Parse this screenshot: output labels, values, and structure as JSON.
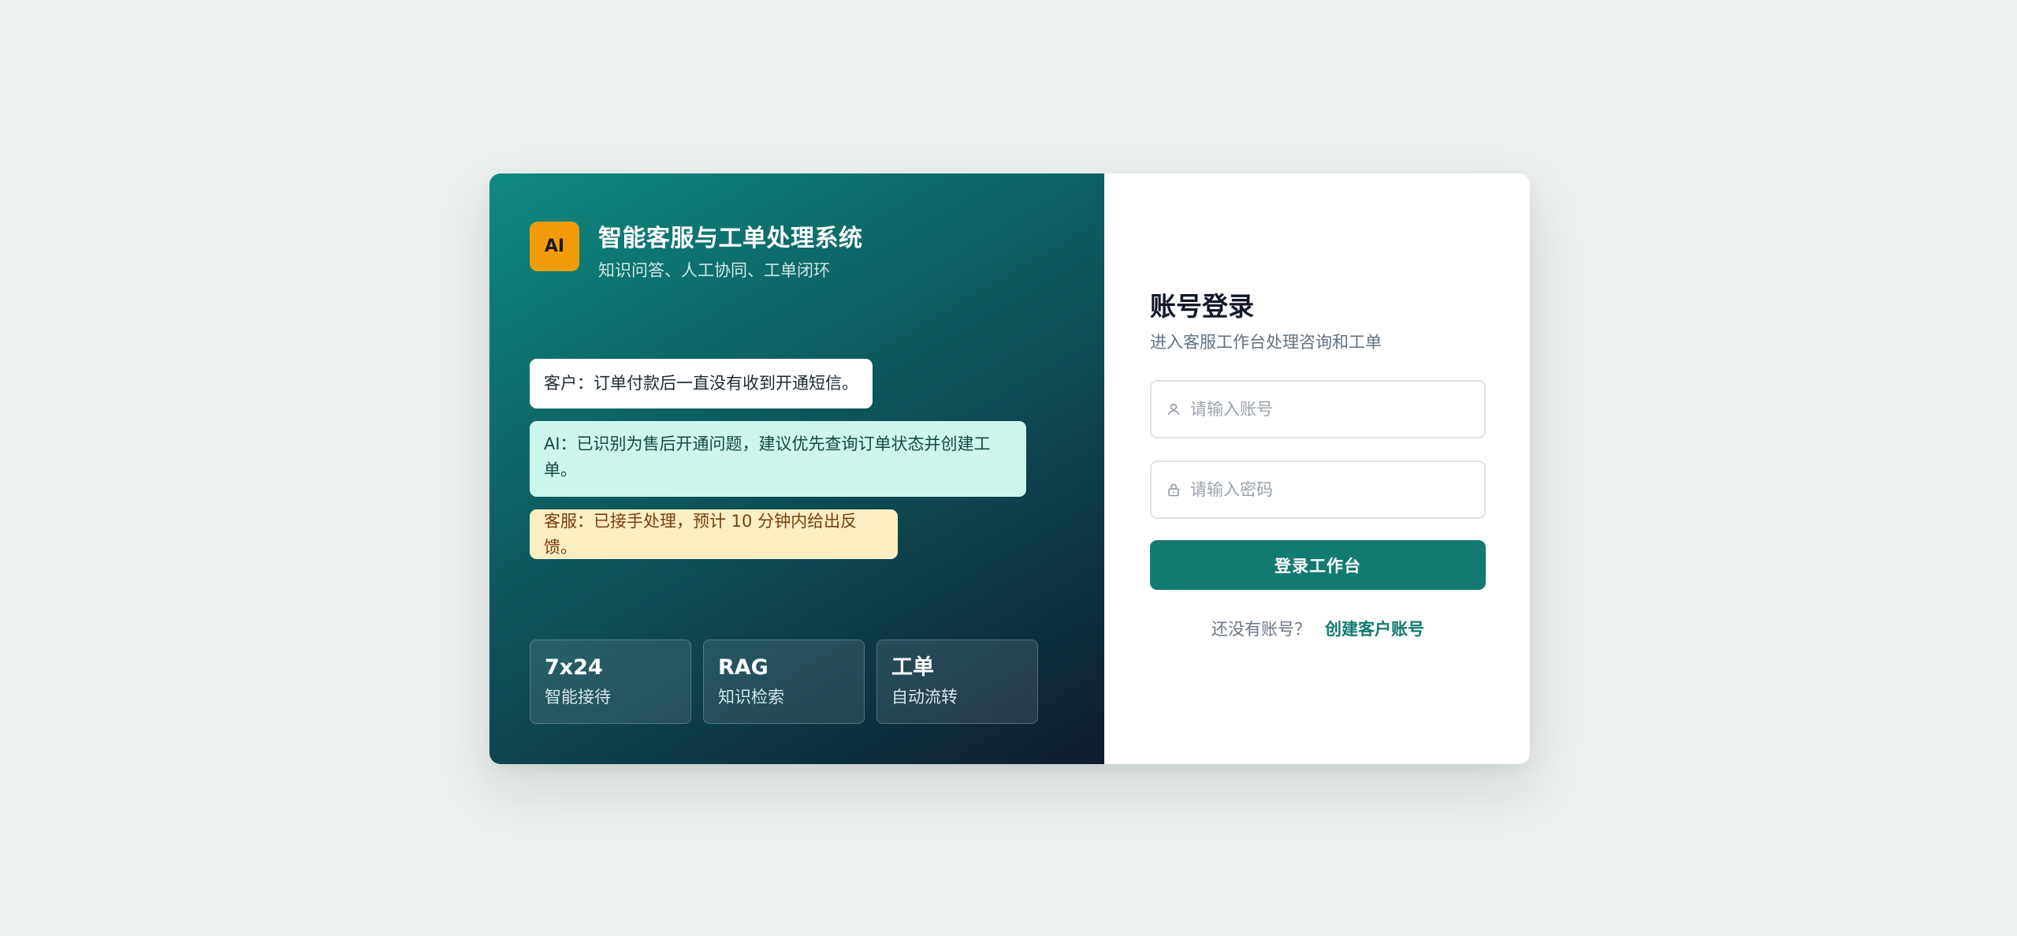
{
  "brand": {
    "logo_text": "AI",
    "title": "智能客服与工单处理系统",
    "subtitle": "知识问答、人工协同、工单闭环"
  },
  "chat": [
    {
      "role": "customer",
      "text": "客户：订单付款后一直没有收到开通短信。"
    },
    {
      "role": "ai",
      "text": "AI：已识别为售后开通问题，建议优先查询订单状态并创建工单。"
    },
    {
      "role": "agent",
      "text": "客服：已接手处理，预计 10 分钟内给出反馈。"
    }
  ],
  "features": [
    {
      "title": "7x24",
      "subtitle": "智能接待"
    },
    {
      "title": "RAG",
      "subtitle": "知识检索"
    },
    {
      "title": "工单",
      "subtitle": "自动流转"
    }
  ],
  "login": {
    "title": "账号登录",
    "subtitle": "进入客服工作台处理咨询和工单",
    "account_placeholder": "请输入账号",
    "account_value": "",
    "password_placeholder": "请输入密码",
    "password_value": "",
    "submit_label": "登录工作台",
    "signup_prompt": "还没有账号？",
    "signup_link": "创建客户账号"
  },
  "icons": {
    "account": "user-icon",
    "password": "lock-icon"
  },
  "colors": {
    "accent": "#137a70",
    "logo_bg": "#f39c0b",
    "page_bg": "#edf1f0",
    "bubble_customer": "#ffffff",
    "bubble_ai": "#cdf7ec",
    "bubble_agent": "#fdeec4"
  }
}
